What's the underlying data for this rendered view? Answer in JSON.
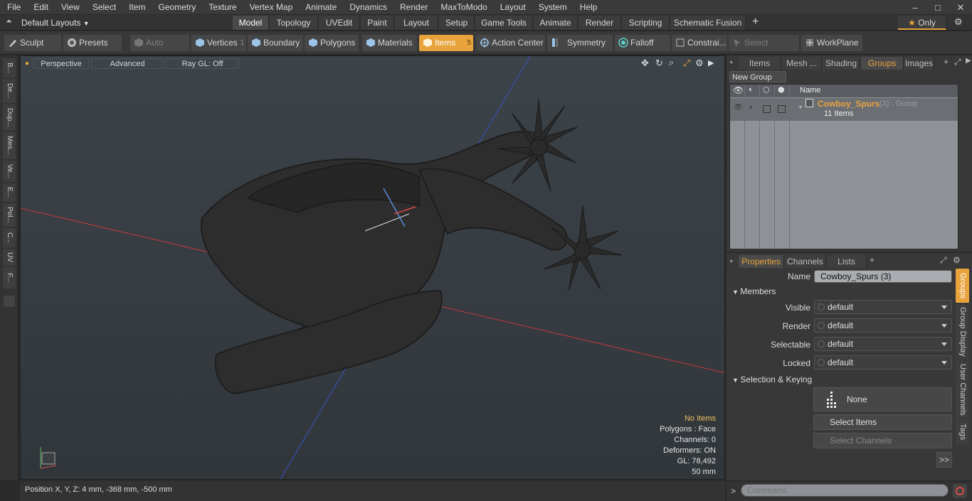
{
  "menu": [
    "File",
    "Edit",
    "View",
    "Select",
    "Item",
    "Geometry",
    "Texture",
    "Vertex Map",
    "Animate",
    "Dynamics",
    "Render",
    "MaxToModo",
    "Layout",
    "System",
    "Help"
  ],
  "layouts": {
    "label": "Default Layouts"
  },
  "layout_tabs": [
    "Model",
    "Topology",
    "UVEdit",
    "Paint",
    "Layout",
    "Setup",
    "Game Tools",
    "Animate",
    "Render",
    "Scripting",
    "Schematic Fusion"
  ],
  "only_label": "Only",
  "toolbar": {
    "sculpt": "Sculpt",
    "presets": "Presets",
    "auto_select": "Auto Select",
    "vertices": "Vertices",
    "vertices_count": "1",
    "boundary": "Boundary",
    "polygons": "Polygons",
    "materials": "Materials",
    "items": "Items",
    "items_count": "5",
    "action_center": "Action Center",
    "symmetry": "Symmetry",
    "falloff": "Falloff",
    "constraints": "Constrai...",
    "select_through": "Select Through",
    "workplane": "WorkPlane"
  },
  "left_tabs": [
    "B...",
    "De...",
    "Dup...",
    "Mes...",
    "Ve...",
    "E...",
    "Pol...",
    "C...",
    "UV",
    "F..."
  ],
  "viewport": {
    "view": "Perspective",
    "advanced": "Advanced",
    "raygl": "Ray GL: Off",
    "hud": [
      "No Items",
      "Polygons : Face",
      "Channels: 0",
      "Deformers: ON",
      "GL: 78,492",
      "50 mm"
    ]
  },
  "status": {
    "position": "Position X, Y, Z:   4 mm, -368 mm, -500 mm"
  },
  "top_tabs": [
    "Items",
    "Mesh ...",
    "Shading",
    "Groups",
    "Images"
  ],
  "new_group": "New Group",
  "group_list": {
    "name_header": "Name",
    "group_name": "Cowboy_Spurs",
    "group_suffix": "(3) : Group",
    "group_items": "11 Items"
  },
  "prop_tabs": [
    "Properties",
    "Channels",
    "Lists"
  ],
  "properties": {
    "name_label": "Name",
    "name_value": "Cowboy_Spurs (3)",
    "members": "Members",
    "visible_label": "Visible",
    "visible_value": "default",
    "render_label": "Render",
    "render_value": "default",
    "selectable_label": "Selectable",
    "selectable_value": "default",
    "locked_label": "Locked",
    "locked_value": "default",
    "sel_keying": "Selection & Keying",
    "none": "None",
    "select_items": "Select Items",
    "select_channels": "Select Channels",
    "more": ">>"
  },
  "vtabs": [
    "Groups",
    "Group Display",
    "User Channels",
    "Tags"
  ],
  "command": {
    "prompt": ">",
    "placeholder": "Command"
  },
  "colors": {
    "accent": "#e8a33c",
    "group_text": "#e8a33c"
  }
}
